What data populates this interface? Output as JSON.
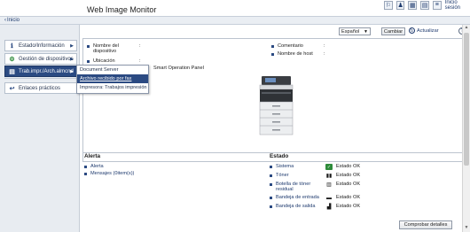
{
  "header": {
    "title": "Web Image Monitor",
    "login_link": "Inicio sesión",
    "icons": [
      "language-icon",
      "user-icon",
      "grid-icon",
      "bookmark-icon",
      "menu-icon"
    ]
  },
  "nav": {
    "back_label": "Inicio"
  },
  "sidebar": {
    "items": [
      {
        "label": "Estado/Información",
        "icon": "info-icon",
        "active": false
      },
      {
        "label": "Gestión de dispositivos",
        "icon": "device-management-icon",
        "active": false
      },
      {
        "label": "Trab.impr./Arch.almcnd",
        "icon": "document-icon",
        "active": true
      },
      {
        "label": "Enlaces prácticos",
        "icon": "link-icon",
        "active": false
      }
    ]
  },
  "flyout": {
    "items": [
      {
        "label": "Document Server",
        "selected": false
      },
      {
        "label": "Archivo recibido por fax",
        "selected": true
      },
      {
        "label": "Impresora: Trabajos impresión",
        "selected": false
      }
    ]
  },
  "toolbar": {
    "language_value": "Español",
    "change_label": "Cambiar",
    "refresh_label": "Actualizar",
    "help": "?"
  },
  "device": {
    "name_label": "Nombre del dispositivo",
    "name_value": ":",
    "location_label": "Ubicación",
    "location_value": ":",
    "panel_value": "Smart Operation Panel",
    "comment_label": "Comentario",
    "comment_value": ":",
    "host_label": "Nombre de host",
    "host_value": ":"
  },
  "alert": {
    "title": "Alerta",
    "links": [
      "Alerta",
      "Mensajes (0item(s))"
    ]
  },
  "status": {
    "title": "Estado",
    "rows": [
      {
        "label": "Sistema",
        "icon": "check-icon",
        "value": "Estado OK"
      },
      {
        "label": "Tóner",
        "icon": "toner-icon",
        "value": "Estado OK"
      },
      {
        "label": "Botella de tóner residual",
        "icon": "waste-toner-icon",
        "value": "Estado OK"
      },
      {
        "label": "Bandeja de entrada",
        "icon": "input-tray-icon",
        "value": "Estado OK"
      },
      {
        "label": "Bandeja de salida",
        "icon": "output-tray-icon",
        "value": "Estado OK"
      }
    ],
    "details_label": "Comprobar detalles"
  },
  "colors": {
    "accent": "#2b4a82",
    "link": "#1e3a6e",
    "ok": "#2e8b3a"
  }
}
